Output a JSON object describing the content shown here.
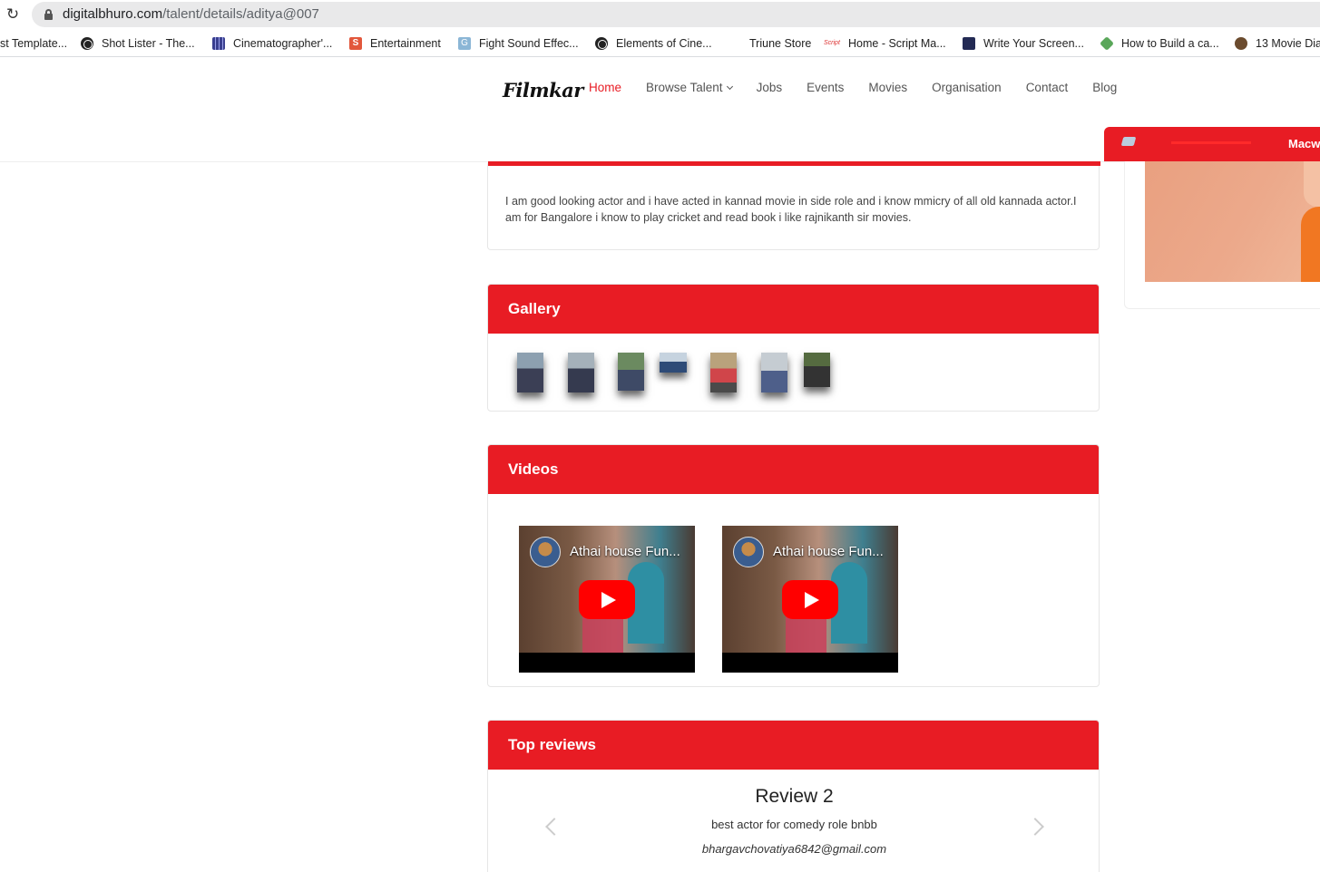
{
  "browser": {
    "url_host": "digitalbhuro.com",
    "url_path": "/talent/details/aditya@007",
    "bookmarks": [
      {
        "label": "st Template...",
        "icon": "none"
      },
      {
        "label": "Shot Lister - The...",
        "icon": "globe-icon"
      },
      {
        "label": "Cinematographer'...",
        "icon": "film-icon"
      },
      {
        "label": "Entertainment",
        "icon": "s-icon"
      },
      {
        "label": "Fight Sound Effec...",
        "icon": "g-icon"
      },
      {
        "label": "Elements of Cine...",
        "icon": "globe-icon"
      },
      {
        "label": "Triune Store",
        "icon": "none"
      },
      {
        "label": "Home - Script Ma...",
        "icon": "script-icon"
      },
      {
        "label": "Write Your Screen...",
        "icon": "book-icon"
      },
      {
        "label": "How to Build a ca...",
        "icon": "green-icon"
      },
      {
        "label": "13 Movie Dia",
        "icon": "movie-icon"
      }
    ]
  },
  "header": {
    "logo": "Filmkar",
    "nav": [
      "Home",
      "Browse Talent",
      "Jobs",
      "Events",
      "Movies",
      "Organisation",
      "Contact",
      "Blog"
    ],
    "active": "Home"
  },
  "side_banner": {
    "label": "Macw"
  },
  "about": {
    "text": "I am good looking actor and i have acted in kannad movie in side role and i know mmicry of all old kannada actor.I am for Bangalore i know to play cricket and read book i like rajnikanth sir movies."
  },
  "gallery": {
    "title": "Gallery",
    "count": 7
  },
  "videos": {
    "title": "Videos",
    "items": [
      {
        "title": "Athai house Fun..."
      },
      {
        "title": "Athai house Fun..."
      }
    ]
  },
  "reviews": {
    "title": "Top reviews",
    "current": {
      "heading": "Review 2",
      "text": "best actor for comedy role bnbb",
      "author": "bhargavchovatiya6842@gmail.com"
    }
  },
  "colors": {
    "brand_red": "#e81c24"
  }
}
